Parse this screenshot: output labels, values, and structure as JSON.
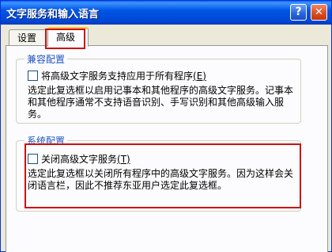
{
  "window": {
    "title": "文字服务和输入语言",
    "help_button": "?",
    "close_button": "✕"
  },
  "tabs": [
    {
      "label": "设置",
      "selected": false
    },
    {
      "label": "高级",
      "selected": true
    }
  ],
  "compat_group": {
    "legend": "兼容配置",
    "checkbox_label": "将高级文字服务支持应用于所有程序",
    "checkbox_shortcut": "(E)",
    "checked": false,
    "description": "选定此复选框以启用记事本和其他程序的高级文字服务。记事本和其他程序通常不支持语音识别、手写识别和其他高级输入服务。"
  },
  "system_group": {
    "legend": "系统配置",
    "checkbox_label": "关闭高级文字服务",
    "checkbox_shortcut": "(T)",
    "checked": false,
    "description": "选定此复选框以关闭所有程序中的高级文字服务。因为这样会关闭语言栏，因此不推荐东亚用户选定此复选框。"
  },
  "colors": {
    "highlight_red": "#cc1010",
    "titlebar_blue": "#0055e5",
    "legend_blue": "#2055c0"
  }
}
